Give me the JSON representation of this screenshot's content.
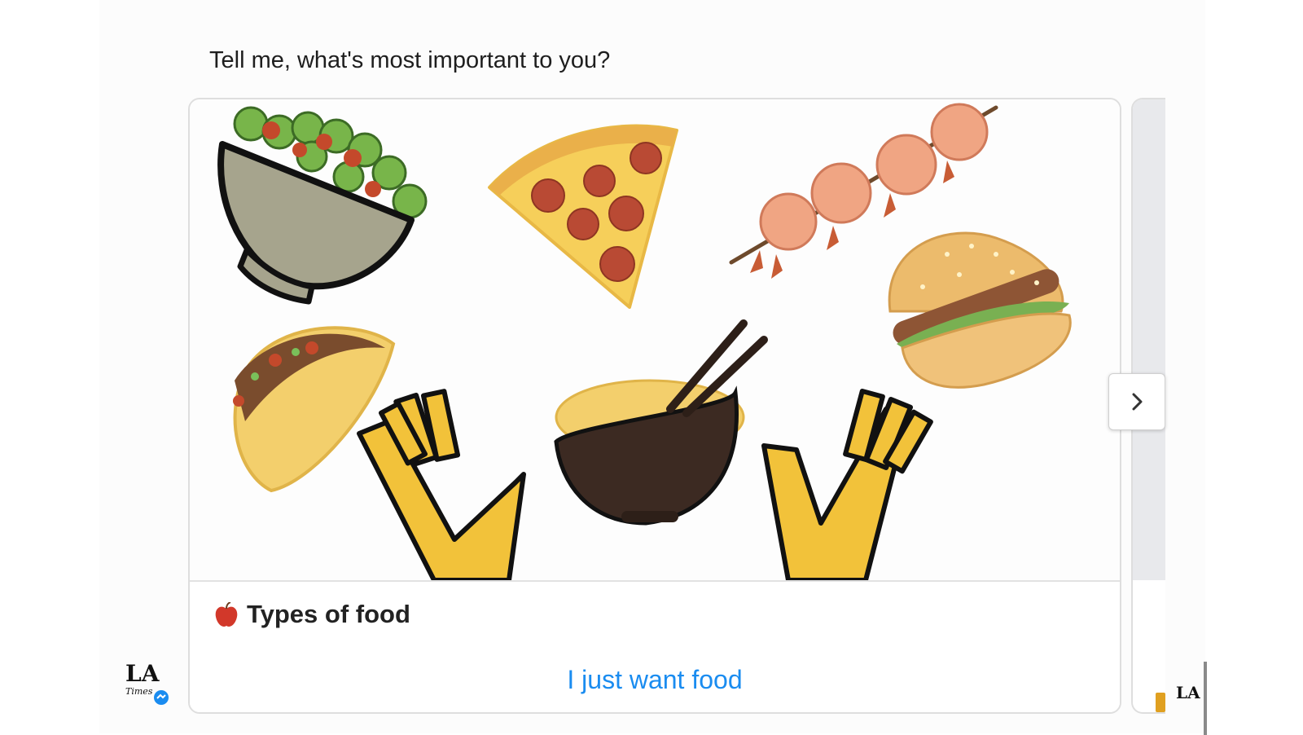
{
  "prompt": "Tell me, what's most important to you?",
  "card": {
    "icon": "apple-icon",
    "title": "Types of food",
    "button_label": "I just want food"
  },
  "carousel": {
    "next_icon": "chevron-right-icon"
  },
  "avatar": {
    "logo_text": "LA",
    "sub_text": "Times",
    "badge_icon": "messenger-badge-icon"
  },
  "colors": {
    "link": "#1a8cf0",
    "robot_gold": "#f2c23a",
    "card_border": "#dedede"
  }
}
